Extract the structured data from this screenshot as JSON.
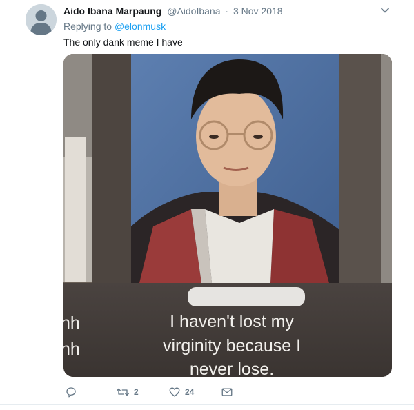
{
  "tweet": {
    "display_name": "Aido Ibana Marpaung",
    "handle": "@AidoIbana",
    "separator": "·",
    "date": "3 Nov 2018",
    "replying_prefix": "Replying to",
    "replying_to": "@elonmusk",
    "text": "The only dank meme I have"
  },
  "media": {
    "caption_line1": "I haven't lost my",
    "caption_line2": "virginity because I",
    "caption_line3": "never lose.",
    "left_edge_line1": "hh",
    "left_edge_line2": "hh"
  },
  "actions": {
    "reply_icon": "reply-icon",
    "retweet_icon": "retweet-icon",
    "retweet_count": "2",
    "like_icon": "heart-icon",
    "like_count": "24",
    "dm_icon": "envelope-icon"
  },
  "colors": {
    "link": "#1da1f2",
    "secondary_text": "#657786",
    "primary_text": "#14171a",
    "avatar_bg": "#ccd6dd"
  }
}
